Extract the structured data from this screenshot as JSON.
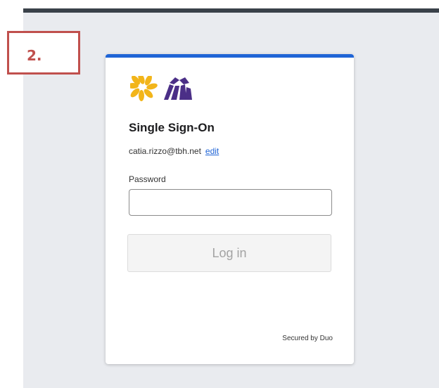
{
  "annotation": {
    "step_label": "2."
  },
  "card": {
    "title": "Single Sign-On",
    "account_email": "catia.rizzo@tbh.net",
    "edit_label": "edit",
    "password_label": "Password",
    "password_value": "",
    "login_label": "Log in",
    "footer": "Secured by Duo",
    "logo_icon": "flower-logo-icon"
  },
  "colors": {
    "accent": "#1f64d6",
    "annotation": "#c0504d",
    "logo_yellow": "#f2b51a",
    "logo_purple": "#4b2f87"
  }
}
